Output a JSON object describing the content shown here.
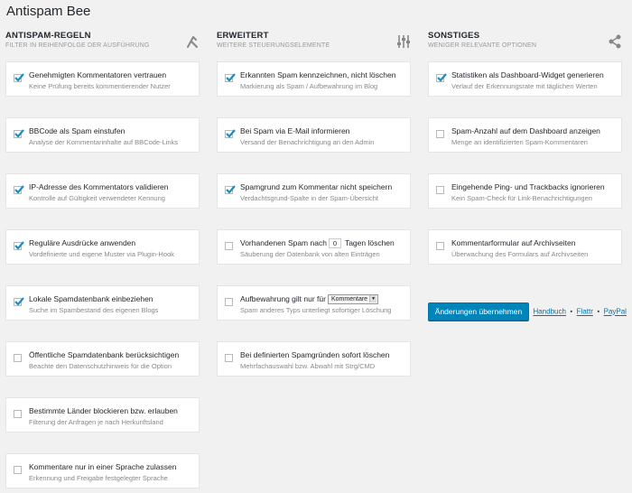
{
  "page": {
    "title": "Antispam Bee"
  },
  "columns": [
    {
      "title": "ANTISPAM-REGELN",
      "subtitle": "FILTER IN REIHENFOLGE DER AUSFÜHRUNG",
      "icon": "rules-icon",
      "options": [
        {
          "label": "Genehmigten Kommentatoren vertrauen",
          "desc": "Keine Prüfung bereits kommentierender Nutzer",
          "checked": true
        },
        {
          "label": "BBCode als Spam einstufen",
          "desc": "Analyse der Kommentarinhalte auf BBCode-Links",
          "checked": true
        },
        {
          "label": "IP-Adresse des Kommentators validieren",
          "desc": "Kontrolle auf Gültigkeit verwendeter Kennung",
          "checked": true
        },
        {
          "label": "Reguläre Ausdrücke anwenden",
          "desc": "Vordefinierte und eigene Muster via Plugin-Hook",
          "checked": true
        },
        {
          "label": "Lokale Spamdatenbank einbeziehen",
          "desc": "Suche im Spambestand des eigenen Blogs",
          "checked": true
        },
        {
          "label": "Öffentliche Spamdatenbank berücksichtigen",
          "desc": "Beachte den Datenschutzhinweis für die Option",
          "checked": false
        },
        {
          "label": "Bestimmte Länder blockieren bzw. erlauben",
          "desc": "Filterung der Anfragen je nach Herkunftsland",
          "checked": false
        },
        {
          "label": "Kommentare nur in einer Sprache zulassen",
          "desc": "Erkennung und Freigabe festgelegter Sprache",
          "checked": false
        }
      ]
    },
    {
      "title": "ERWEITERT",
      "subtitle": "WEITERE STEUERUNGSELEMENTE",
      "icon": "sliders-icon",
      "options": [
        {
          "label": "Erkannten Spam kennzeichnen, nicht löschen",
          "desc": "Markierung als Spam / Aufbewahrung im Blog",
          "checked": true
        },
        {
          "label": "Bei Spam via E-Mail informieren",
          "desc": "Versand der Benachrichtigung an den Admin",
          "checked": true
        },
        {
          "label": "Spamgrund zum Kommentar nicht speichern",
          "desc": "Verdachtsgrund-Spalte in der Spam-Übersicht",
          "checked": true
        },
        {
          "label_before": "Vorhandenen Spam nach",
          "input_value": "0",
          "label_after": "Tagen löschen",
          "desc": "Säuberung der Datenbank von alten Einträgen",
          "checked": false
        },
        {
          "label_before": "Aufbewahrung gilt nur für",
          "select_value": "Kommentare",
          "desc": "Spam anderes Typs unterliegt sofortiger Löschung",
          "checked": false
        },
        {
          "label": "Bei definierten Spamgründen sofort löschen",
          "desc": "Mehrfachauswahl bzw. Abwahl mit Strg/CMD",
          "checked": false
        }
      ]
    },
    {
      "title": "SONSTIGES",
      "subtitle": "WENIGER RELEVANTE OPTIONEN",
      "icon": "share-icon",
      "options": [
        {
          "label": "Statistiken als Dashboard-Widget generieren",
          "desc": "Verlauf der Erkennungsrate mit täglichen Werten",
          "checked": true
        },
        {
          "label": "Spam-Anzahl auf dem Dashboard anzeigen",
          "desc": "Menge an identifizierten Spam-Kommentaren",
          "checked": false
        },
        {
          "label": "Eingehende Ping- und Trackbacks ignorieren",
          "desc": "Kein Spam-Check für Link-Benachrichtigungen",
          "checked": false
        },
        {
          "label": "Kommentarformular auf Archivseiten",
          "desc": "Überwachung des Formulars auf Archivseiten",
          "checked": false
        }
      ]
    }
  ],
  "footer": {
    "save_label": "Änderungen übernehmen",
    "links": [
      "Handbuch",
      "Flattr",
      "PayPal"
    ],
    "separator": "•"
  },
  "colors": {
    "accent": "#0085ba",
    "link": "#0073aa",
    "background": "#f1f1f1"
  }
}
